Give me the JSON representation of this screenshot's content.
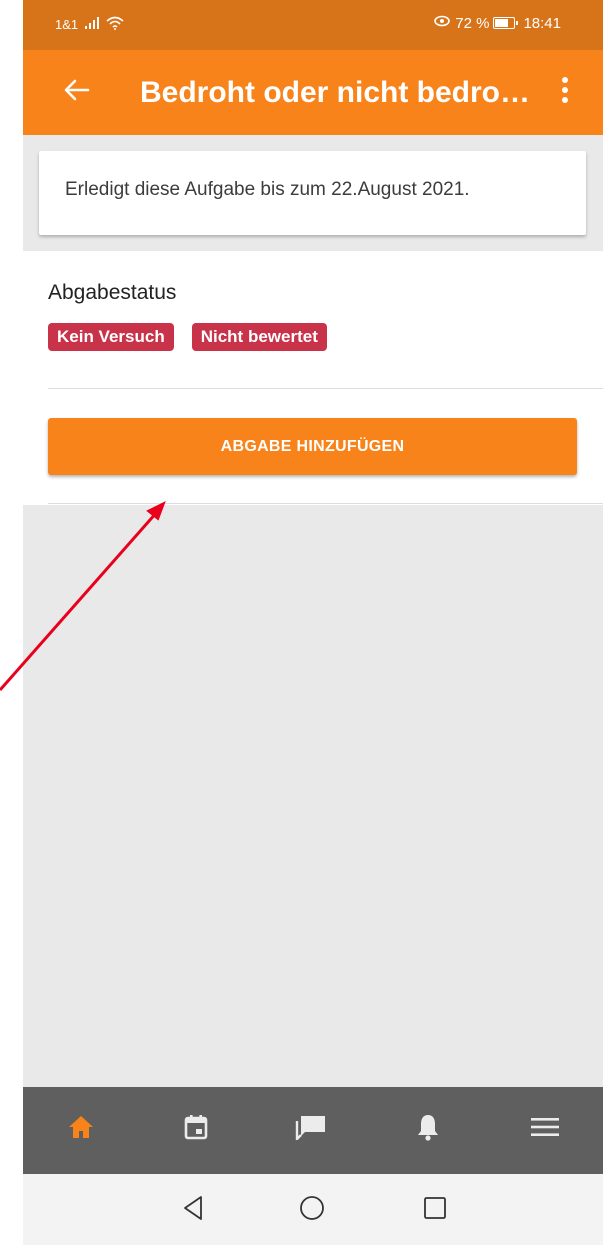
{
  "status_bar": {
    "carrier": "1&1",
    "battery_percent": "72 %",
    "time": "18:41"
  },
  "app_bar": {
    "title": "Bedroht oder nicht bedro…",
    "back_icon": "arrow-left-icon",
    "menu_icon": "more-vertical-icon"
  },
  "due_card": {
    "text": "Erledigt diese Aufgabe bis zum 22.August 2021."
  },
  "submission": {
    "heading": "Abgabestatus",
    "badges": [
      "Kein Versuch",
      "Nicht bewertet"
    ],
    "add_button_label": "ABGABE HINZUFÜGEN"
  },
  "bottom_nav": {
    "items": [
      {
        "icon": "home-icon",
        "active": true
      },
      {
        "icon": "calendar-icon",
        "active": false
      },
      {
        "icon": "messages-icon",
        "active": false
      },
      {
        "icon": "bell-icon",
        "active": false
      },
      {
        "icon": "menu-icon",
        "active": false
      }
    ]
  },
  "system_nav": {
    "items": [
      "back-triangle-icon",
      "home-circle-icon",
      "recents-square-icon"
    ]
  },
  "colors": {
    "accent": "#f7831a",
    "status_bar": "#d7741a",
    "badge": "#c8334a",
    "nav_bg": "#5f5f5f",
    "annotation_arrow": "#e8001c"
  }
}
